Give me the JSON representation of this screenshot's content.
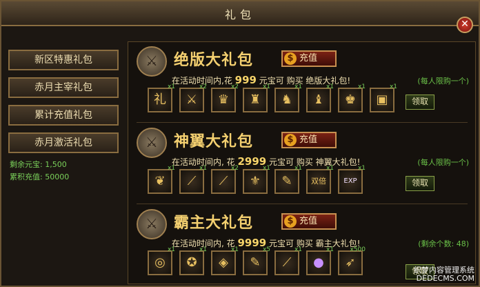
{
  "window": {
    "title": "礼包",
    "close_label": "✕"
  },
  "sidebar": {
    "tabs": [
      {
        "label": "新区特惠礼包"
      },
      {
        "label": "赤月主宰礼包"
      },
      {
        "label": "累计充值礼包"
      },
      {
        "label": "赤月激活礼包"
      }
    ],
    "remaining_ingots_label": "剩余元宝: 1,500",
    "total_recharge_label": "累积充值: 50000"
  },
  "packs": [
    {
      "title": "绝版大礼包",
      "charge_label": "充值",
      "desc_pre": "在活动时间内,花",
      "cost": "999",
      "desc_post": "元宝可 购买 绝版大礼包!",
      "note": "(每人限购一个)",
      "claim_label": "领取",
      "items": [
        {
          "icon": "礼",
          "qty": "x1"
        },
        {
          "icon": "⚔",
          "qty": "x2"
        },
        {
          "icon": "♛",
          "qty": "x2"
        },
        {
          "icon": "♜",
          "qty": "x1"
        },
        {
          "icon": "♞",
          "qty": "x1"
        },
        {
          "icon": "♝",
          "qty": "x1"
        },
        {
          "icon": "♚",
          "qty": "x1"
        },
        {
          "icon": "▣",
          "qty": "x1"
        }
      ]
    },
    {
      "title": "神翼大礼包",
      "charge_label": "充值",
      "desc_pre": "在活动时间内, 花",
      "cost": "2999",
      "desc_post": "元宝可 购买 神翼大礼包!",
      "note": "(每人限购一个)",
      "claim_label": "领取",
      "items": [
        {
          "icon": "❦",
          "qty": "x1"
        },
        {
          "icon": "⟋",
          "qty": "x1"
        },
        {
          "icon": "⟋",
          "qty": "x2"
        },
        {
          "icon": "⚜",
          "qty": "x1"
        },
        {
          "icon": "✎",
          "qty": "x1"
        },
        {
          "icon": "双倍",
          "qty": "x1"
        },
        {
          "icon": "EXP",
          "qty": "x1"
        }
      ]
    },
    {
      "title": "霸主大礼包",
      "charge_label": "充值",
      "desc_pre": "在活动时间内, 花",
      "cost": "9999",
      "desc_post": "元宝可 购买 霸主大礼包!",
      "note": "(剩余个数: 48)",
      "claim_label": "领取",
      "items": [
        {
          "icon": "◎",
          "qty": "x1"
        },
        {
          "icon": "✪",
          "qty": "x1"
        },
        {
          "icon": "◈",
          "qty": "x1"
        },
        {
          "icon": "✎",
          "qty": "x5"
        },
        {
          "icon": "⟋",
          "qty": "x1"
        },
        {
          "icon": "●",
          "qty": "x1"
        },
        {
          "icon": "➶",
          "qty": "x500"
        }
      ]
    }
  ],
  "watermark": {
    "line1": "织梦内容管理系统",
    "line2": "DEDECMS.COM"
  }
}
